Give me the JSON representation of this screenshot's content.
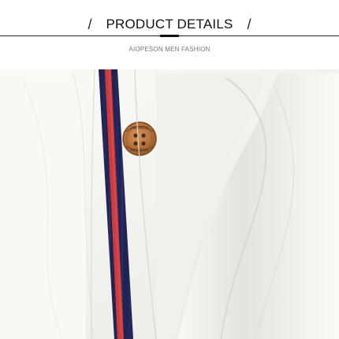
{
  "header": {
    "title": "PRODUCT DETAILS",
    "subtitle": "AIOPESON MEN FASHION",
    "separator_left": "/",
    "separator_right": "/"
  },
  "image": {
    "subject": "shirt-placket-button-closeup",
    "colors": {
      "shirt": "#f6f6f3",
      "stripe_navy": "#1f2454",
      "stripe_red": "#cf3b3b",
      "button": "#b6753e"
    },
    "button_text": "FASHION FASHION"
  }
}
